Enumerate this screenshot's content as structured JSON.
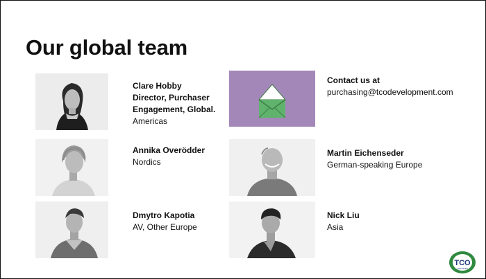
{
  "slide": {
    "title": "Our global team",
    "contact": {
      "label": "Contact us at",
      "email": "purchasing@tcodevelopment.com"
    },
    "members": [
      {
        "name": "Clare Hobby",
        "role": "Director, Purchaser Engagement, Global.",
        "region": "Americas"
      },
      {
        "name": "Annika Overödder",
        "region": "Nordics"
      },
      {
        "name": "Dmytro Kapotia",
        "region": "AV, Other Europe"
      },
      {
        "name": "Martin Eichenseder",
        "region": "German-speaking Europe"
      },
      {
        "name": "Nick Liu",
        "region": "Asia"
      }
    ],
    "logo": {
      "text": "TCO",
      "subtext": "CERTIFIED",
      "colors": {
        "green": "#2f8a3f",
        "navy": "#1d3a7a"
      }
    },
    "colors": {
      "envelope_bg": "#a387b8",
      "envelope_green": "#5fb36d"
    }
  }
}
